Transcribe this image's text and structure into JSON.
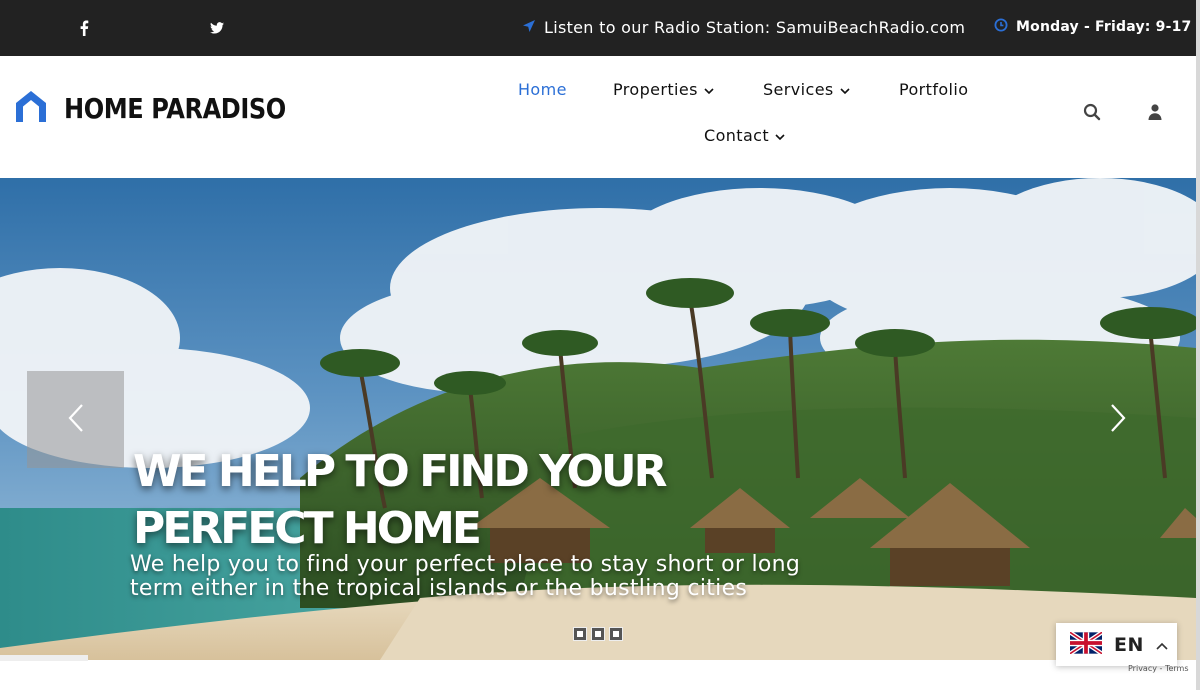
{
  "topbar": {
    "social": [
      {
        "name": "facebook",
        "glyph": "f"
      },
      {
        "name": "twitter",
        "glyph": "twitter"
      }
    ],
    "radio_text": "Listen to our Radio Station: SamuiBeachRadio.com",
    "hours_text": "Monday - Friday: 9-17",
    "icon_color": "#2b6fd6"
  },
  "header": {
    "logo_text": "HOME PARADISO",
    "nav": [
      {
        "label": "Home",
        "active": true,
        "dropdown": false
      },
      {
        "label": "Properties",
        "active": false,
        "dropdown": true
      },
      {
        "label": "Services",
        "active": false,
        "dropdown": true
      },
      {
        "label": "Portfolio",
        "active": false,
        "dropdown": false
      },
      {
        "label": "Contact",
        "active": false,
        "dropdown": true
      }
    ],
    "icons": [
      "search-icon",
      "user-icon"
    ]
  },
  "hero": {
    "headline_line1": "WE HELP TO FIND YOUR",
    "headline_line2": "PERFECT HOME",
    "subline": "We help you to find your perfect place to stay short or long term either in the tropical islands or the bustling cities",
    "slide_count": 3,
    "active_slide": 1
  },
  "language": {
    "code": "EN",
    "flag": "uk-flag-icon"
  },
  "recaptcha_text": "Privacy - Terms",
  "colors": {
    "accent": "#2b6fd6",
    "topbar_bg": "#222222"
  }
}
